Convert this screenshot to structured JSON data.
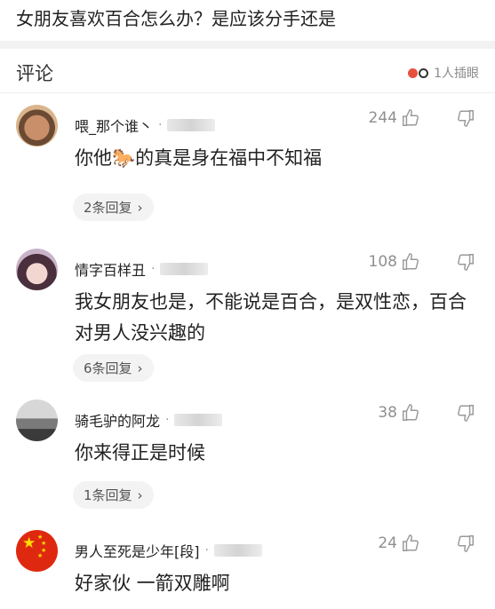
{
  "header": {
    "title": "女朋友喜欢百合怎么办？是应该分手还是"
  },
  "section": {
    "title": "评论",
    "reaction_text": "1人插眼"
  },
  "comments": [
    {
      "username": "喂_那个谁丶",
      "likes": "244",
      "text": "你他🐎的真是身在福中不知福",
      "replies": "2条回复"
    },
    {
      "username": "情字百样丑",
      "likes": "108",
      "text": "我女朋友也是，不能说是百合，是双性恋，百合对男人没兴趣的",
      "replies": "6条回复"
    },
    {
      "username": "骑毛驴的阿龙",
      "likes": "38",
      "text": "你来得正是时候",
      "replies": "1条回复"
    },
    {
      "username": "男人至死是少年[段]",
      "likes": "24",
      "text": "好家伙 一箭双雕啊"
    }
  ],
  "icons": {
    "like": "thumb-up-icon",
    "dislike": "thumb-down-icon",
    "chevron": "chevron-right-icon",
    "reaction": "eyes-icon"
  },
  "colors": {
    "divider": "#f2f2f2",
    "meta": "#8f8f8f",
    "pill": "#f3f3f3"
  }
}
